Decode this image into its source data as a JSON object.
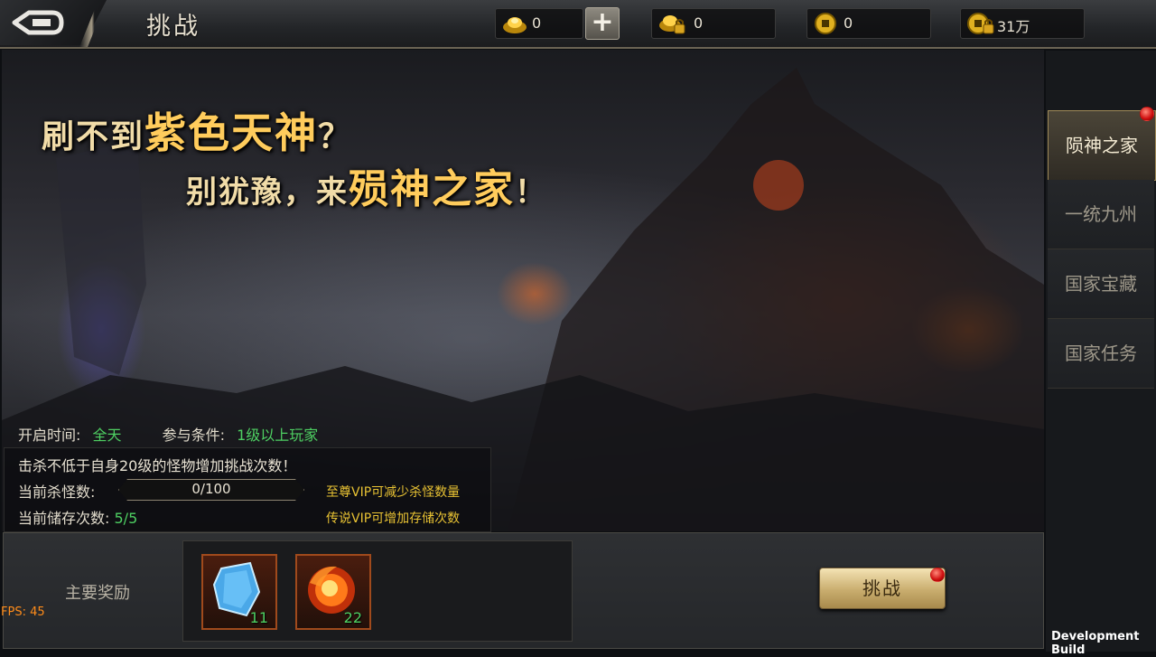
{
  "header": {
    "title": "挑战",
    "resources": [
      {
        "icon": "gold-ingot-icon",
        "value": "0"
      },
      {
        "icon": "locked-ingot-icon",
        "value": "0"
      },
      {
        "icon": "coin-icon",
        "value": "0"
      },
      {
        "icon": "locked-coin-icon",
        "value": "31万"
      }
    ],
    "plus": "+"
  },
  "banner": {
    "slogan_line1_a": "刷不到",
    "slogan_line1_b": "紫色天神",
    "slogan_line1_c": "？",
    "slogan_line2_a": "别犹豫，来",
    "slogan_line2_b": "殒神之家",
    "slogan_line2_c": "！"
  },
  "info": {
    "open_time_label": "开启时间:",
    "open_time_value": "全天",
    "condition_label": "参与条件:",
    "condition_value": "1级以上玩家",
    "kill_tip": "击杀不低于自身20级的怪物增加挑战次数！",
    "kill_label": "当前杀怪数:",
    "kill_progress_text": "0/100",
    "kill_progress": 0,
    "store_label": "当前储存次数:",
    "store_value": "5/5",
    "vip_tip1": "至尊VIP可减少杀怪数量",
    "vip_tip2": "传说VIP可增加存储次数"
  },
  "rewards": {
    "title": "主要奖励",
    "items": [
      {
        "icon": "blue-crystal-icon",
        "count": "11"
      },
      {
        "icon": "fire-orb-icon",
        "count": "22"
      }
    ]
  },
  "challenge_button": "挑战",
  "side_tabs": [
    {
      "label": "陨神之家",
      "active": true
    },
    {
      "label": "一统九州",
      "active": false
    },
    {
      "label": "国家宝藏",
      "active": false
    },
    {
      "label": "国家任务",
      "active": false
    }
  ],
  "debug": {
    "fps": "FPS: 45",
    "build": "Development Build"
  },
  "colors": {
    "accent_gold": "#ffcc5c",
    "value_green": "#4ecf62",
    "vip_yellow": "#e8c233",
    "notify_red": "#d01010"
  }
}
